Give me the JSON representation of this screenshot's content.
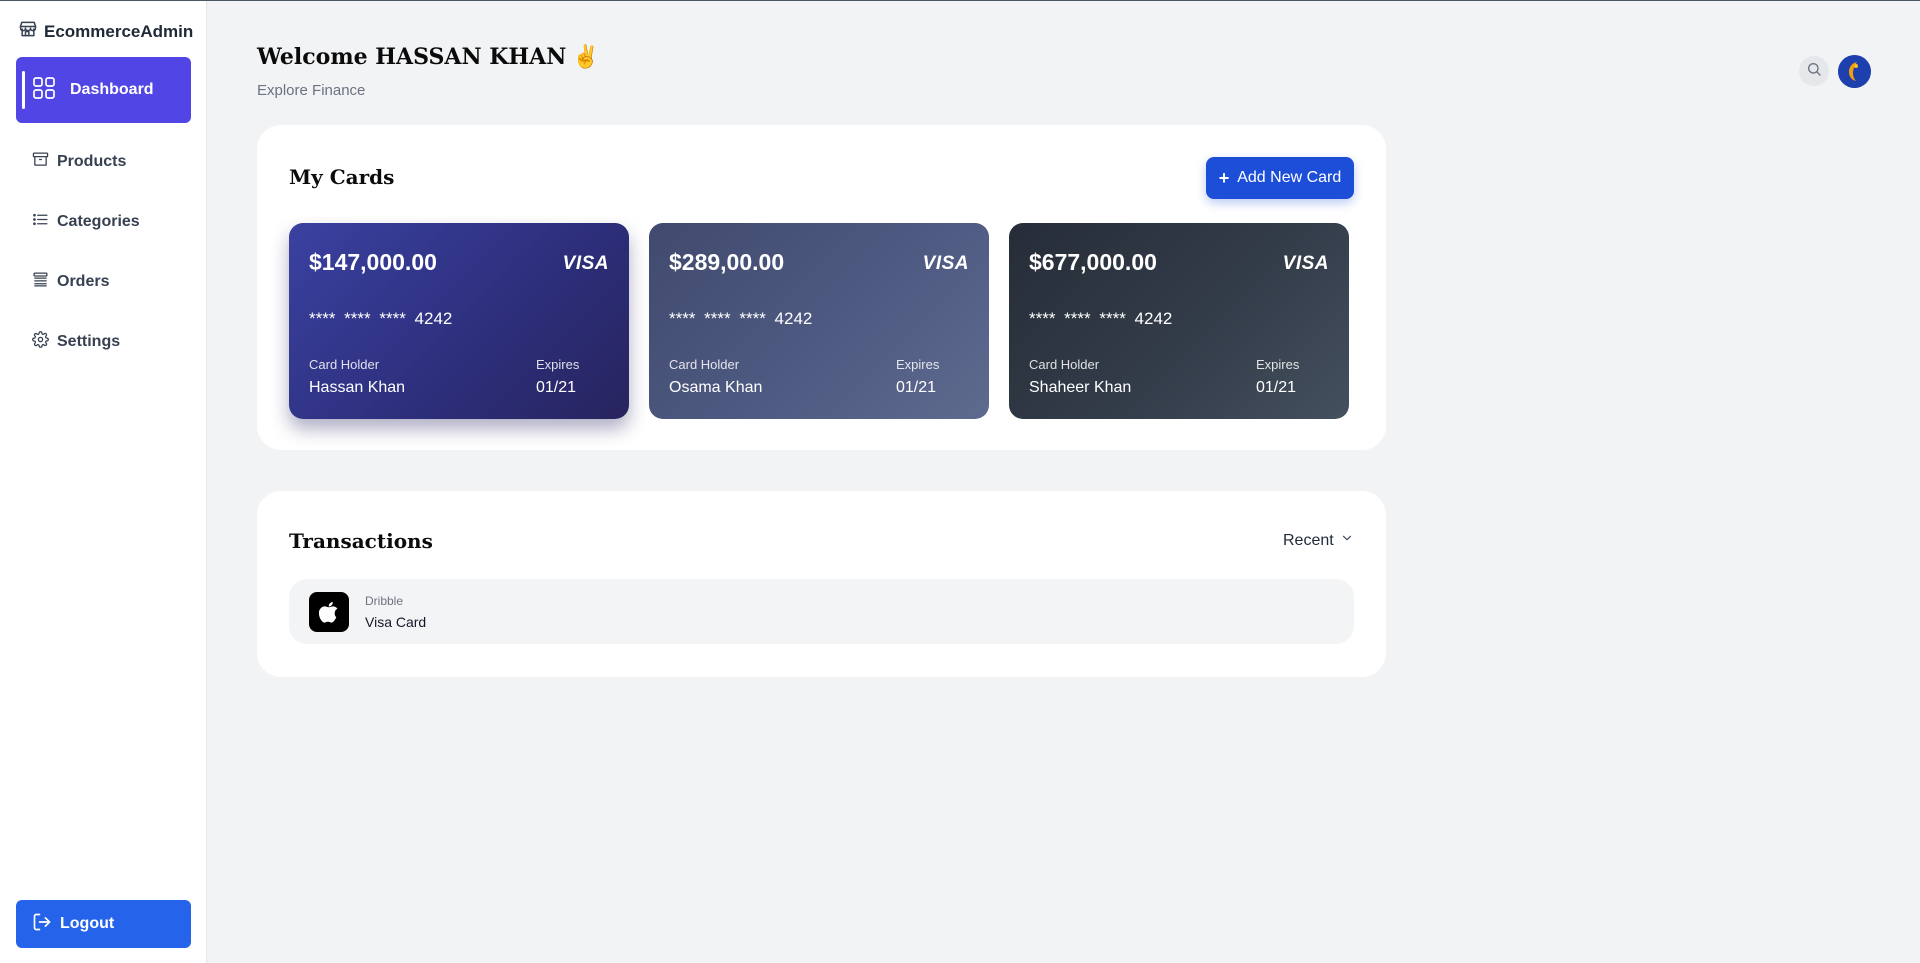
{
  "sidebar": {
    "brand": "EcommerceAdmin",
    "items": [
      {
        "label": "Dashboard",
        "icon": "grid-icon",
        "active": true
      },
      {
        "label": "Products",
        "icon": "archive-icon"
      },
      {
        "label": "Categories",
        "icon": "list-icon"
      },
      {
        "label": "Orders",
        "icon": "stack-icon"
      },
      {
        "label": "Settings",
        "icon": "gear-icon"
      }
    ],
    "logout_label": "Logout"
  },
  "header": {
    "welcome": "Welcome HASSAN KHAN",
    "emoji": "✌",
    "subtitle": "Explore Finance"
  },
  "cards_section": {
    "title": "My Cards",
    "add_button_label": "Add New Card",
    "cards": [
      {
        "amount": "$147,000.00",
        "brand": "VISA",
        "number": "**** **** **** 4242",
        "holder_label": "Card Holder",
        "holder": "Hassan Khan",
        "expires_label": "Expires",
        "expires": "01/21"
      },
      {
        "amount": "$289,00.00",
        "brand": "VISA",
        "number": "**** **** **** 4242",
        "holder_label": "Card Holder",
        "holder": "Osama Khan",
        "expires_label": "Expires",
        "expires": "01/21"
      },
      {
        "amount": "$677,000.00",
        "brand": "VISA",
        "number": "**** **** **** 4242",
        "holder_label": "Card Holder",
        "holder": "Shaheer Khan",
        "expires_label": "Expires",
        "expires": "01/21"
      }
    ]
  },
  "transactions": {
    "title": "Transactions",
    "filter_label": "Recent",
    "items": [
      {
        "merchant": "Dribble",
        "method": "Visa Card",
        "icon": "apple-icon"
      }
    ]
  },
  "colors": {
    "primary": "#5145e5",
    "accent_blue": "#1d4ed8",
    "logout_blue": "#2563eb",
    "background": "#f2f3f5"
  }
}
